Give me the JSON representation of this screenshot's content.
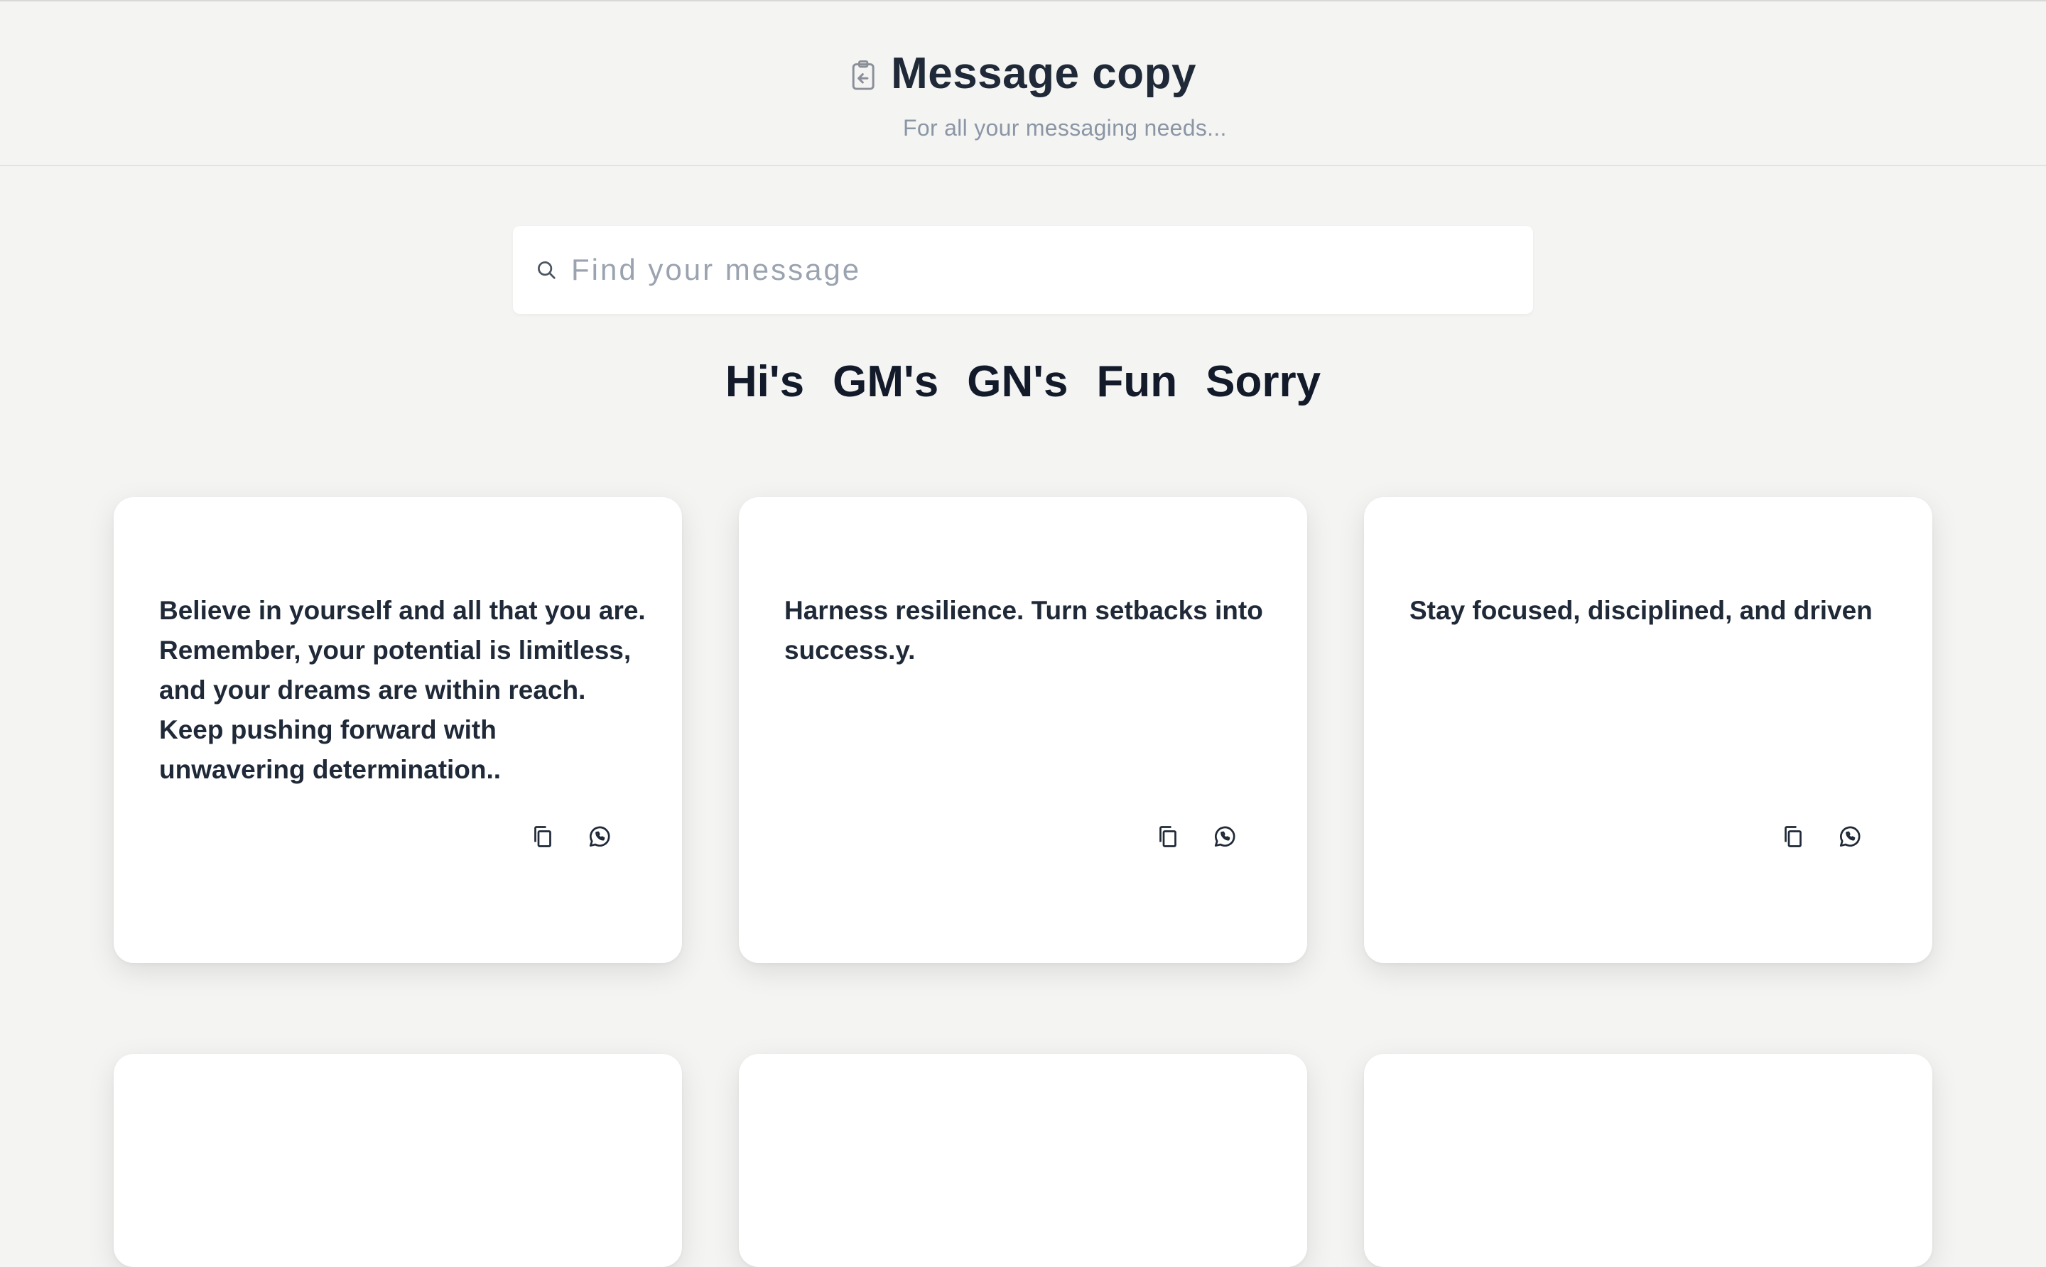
{
  "header": {
    "title": "Message copy",
    "subtitle": "For all your messaging needs...",
    "icon": "clipboard-arrow-icon"
  },
  "search": {
    "placeholder": "Find your message",
    "value": "",
    "icon": "search-icon"
  },
  "categories": [
    "Hi's",
    "GM's",
    "GN's",
    "Fun",
    "Sorry"
  ],
  "cards": [
    {
      "text": "Believe in yourself and all that you are. Remember, your potential is limitless, and your dreams are within reach. Keep pushing forward with unwavering determination..",
      "actions": [
        "copy-icon",
        "whatsapp-icon"
      ]
    },
    {
      "text": "Harness resilience. Turn setbacks into success.y.",
      "actions": [
        "copy-icon",
        "whatsapp-icon"
      ]
    },
    {
      "text": "Stay focused, disciplined, and driven",
      "actions": [
        "copy-icon",
        "whatsapp-icon"
      ]
    }
  ],
  "colors": {
    "background": "#f4f4f3",
    "card": "#ffffff",
    "title": "#1f2937",
    "subtitle": "#8b96a5",
    "placeholder": "#9aa3af"
  }
}
